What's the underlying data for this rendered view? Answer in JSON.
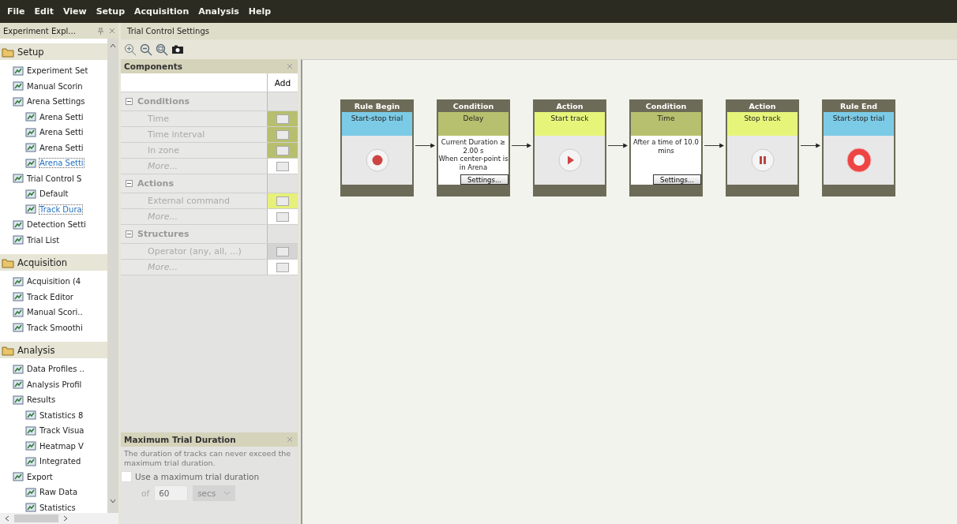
{
  "menu": [
    "File",
    "Edit",
    "View",
    "Setup",
    "Acquisition",
    "Analysis",
    "Help"
  ],
  "explorer": {
    "title": "Experiment Expl...",
    "sections": [
      {
        "label": "Setup",
        "items": [
          {
            "label": "Experiment Set",
            "selected": false
          },
          {
            "label": "Manual Scorin",
            "selected": false
          },
          {
            "label": "Arena Settings",
            "selected": false,
            "children": [
              {
                "label": "Arena Setti",
                "selected": false
              },
              {
                "label": "Arena Setti",
                "selected": false
              },
              {
                "label": "Arena Setti",
                "selected": false
              },
              {
                "label": "Arena Setti",
                "selected": true
              }
            ]
          },
          {
            "label": "Trial Control S",
            "selected": false,
            "children": [
              {
                "label": "Default",
                "selected": false
              },
              {
                "label": "Track Dura",
                "selected": true
              }
            ]
          },
          {
            "label": "Detection Setti",
            "selected": false
          },
          {
            "label": "Trial List",
            "selected": false
          }
        ]
      },
      {
        "label": "Acquisition",
        "items": [
          {
            "label": "Acquisition (4",
            "selected": false
          },
          {
            "label": "Track Editor",
            "selected": false
          },
          {
            "label": "Manual Scori..",
            "selected": false
          },
          {
            "label": "Track Smoothi",
            "selected": false
          }
        ]
      },
      {
        "label": "Analysis",
        "items": [
          {
            "label": "Data Profiles ..",
            "selected": false
          },
          {
            "label": "Analysis Profil",
            "selected": false
          },
          {
            "label": "Results",
            "selected": false,
            "children": [
              {
                "label": "Statistics 8",
                "selected": false
              },
              {
                "label": "Track Visua",
                "selected": false
              },
              {
                "label": "Heatmap V",
                "selected": false
              },
              {
                "label": "Integrated",
                "selected": false
              }
            ]
          },
          {
            "label": "Export",
            "selected": false,
            "children": [
              {
                "label": "Raw Data",
                "selected": false
              },
              {
                "label": "Statistics",
                "selected": false
              }
            ]
          }
        ]
      }
    ]
  },
  "document": {
    "title": "Trial Control Settings"
  },
  "components": {
    "title": "Components",
    "add_label": "Add",
    "sections": [
      {
        "label": "Conditions",
        "items": [
          {
            "label": "Time",
            "kind": "component",
            "color": "#b7bf6e"
          },
          {
            "label": "Time interval",
            "kind": "component",
            "color": "#b7bf6e"
          },
          {
            "label": "In zone",
            "kind": "component",
            "color": "#b7bf6e"
          },
          {
            "label": "More...",
            "kind": "more",
            "color": "#ffffff"
          }
        ]
      },
      {
        "label": "Actions",
        "items": [
          {
            "label": "External command",
            "kind": "component",
            "color": "#e6f07a"
          },
          {
            "label": "More...",
            "kind": "more",
            "color": "#ffffff"
          }
        ]
      },
      {
        "label": "Structures",
        "items": [
          {
            "label": "Operator (any, all, ...)",
            "kind": "component",
            "color": "#d4d4d4"
          },
          {
            "label": "More...",
            "kind": "more",
            "color": "#ffffff"
          }
        ]
      }
    ]
  },
  "max_duration": {
    "title": "Maximum Trial Duration",
    "description": "The duration of tracks can never exceed the maximum trial duration.",
    "checked": false,
    "checkbox_label": "Use a maximum trial duration",
    "of_label": "of",
    "value": "60",
    "unit": "secs"
  },
  "flow": [
    {
      "category": "Rule Begin",
      "name": "Start-stop trial",
      "color": "#7ccbe6",
      "kind": "record"
    },
    {
      "category": "Condition",
      "name": "Delay",
      "color": "#b7c06e",
      "kind": "text",
      "lines": [
        "Current Duration ≥ 2.00 s",
        "When center-point is in Arena"
      ],
      "button": "Settings..."
    },
    {
      "category": "Action",
      "name": "Start track",
      "color": "#e6f57a",
      "kind": "play"
    },
    {
      "category": "Condition",
      "name": "Time",
      "color": "#b7c06e",
      "kind": "text",
      "lines": [
        "After a time of 10.0 mins"
      ],
      "button": "Settings..."
    },
    {
      "category": "Action",
      "name": "Stop track",
      "color": "#e6f57a",
      "kind": "pause"
    },
    {
      "category": "Rule End",
      "name": "Start-stop trial",
      "color": "#7ccbe6",
      "kind": "stop"
    }
  ]
}
